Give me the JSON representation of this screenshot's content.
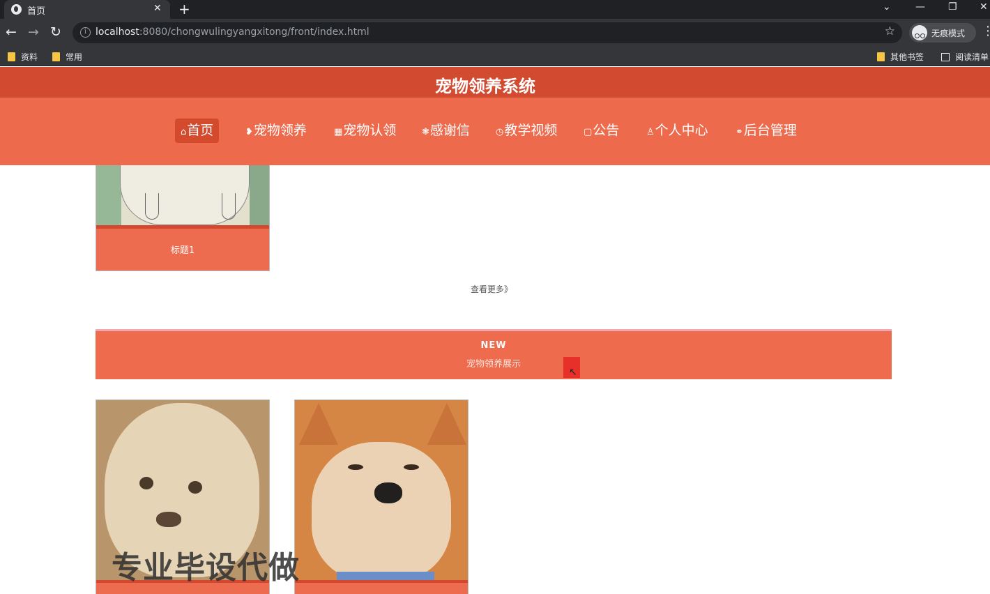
{
  "browser": {
    "tab_title": "首页",
    "tab_close": "✕",
    "new_tab": "+",
    "url_host": "localhost",
    "url_rest": ":8080/chongwulingyangxitong/front/index.html",
    "incognito_label": "无痕模式",
    "bookmarks": [
      "资料",
      "常用",
      "其他书签",
      "阅读清单"
    ]
  },
  "site": {
    "title": "宠物领养系统",
    "nav": [
      {
        "icon": "⌂",
        "label": "首页"
      },
      {
        "icon": "❥",
        "label": "宠物领养"
      },
      {
        "icon": "▦",
        "label": "宠物认领"
      },
      {
        "icon": "❃",
        "label": "感谢信"
      },
      {
        "icon": "◷",
        "label": "教学视频"
      },
      {
        "icon": "▢",
        "label": "公告"
      },
      {
        "icon": "♙",
        "label": "个人中心"
      },
      {
        "icon": "⚭",
        "label": "后台管理"
      }
    ],
    "card_caption": "标题1",
    "more_link": "查看更多》",
    "banner_title": "NEW",
    "banner_subtitle": "宠物领养展示",
    "watermark": "专业毕设代做"
  },
  "colors": {
    "header": "#d24b31",
    "nav": "#ee6a4c",
    "accent": "#d44a2d"
  }
}
